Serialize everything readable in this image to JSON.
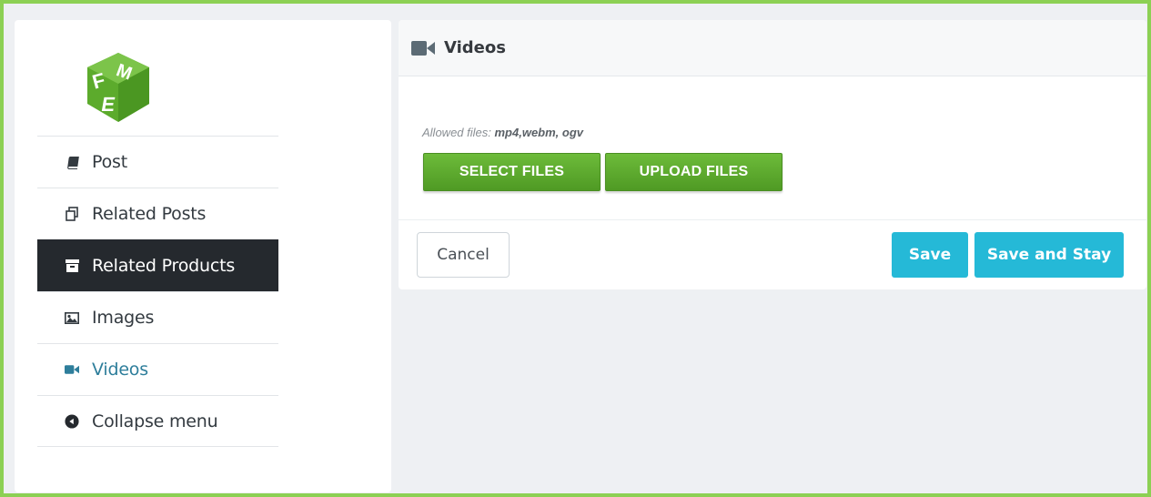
{
  "sidebar": {
    "logo_letters": "FME",
    "items": [
      {
        "label": "Post",
        "icon": "book-icon",
        "state": "normal"
      },
      {
        "label": "Related Posts",
        "icon": "copy-icon",
        "state": "normal"
      },
      {
        "label": "Related Products",
        "icon": "archive-box-icon",
        "state": "active"
      },
      {
        "label": "Images",
        "icon": "image-icon",
        "state": "normal"
      },
      {
        "label": "Videos",
        "icon": "video-camera-icon",
        "state": "current"
      },
      {
        "label": "Collapse menu",
        "icon": "collapse-arrow-icon",
        "state": "normal"
      }
    ]
  },
  "panel": {
    "title": "Videos",
    "title_icon": "video-camera-icon",
    "allowed_prefix": "Allowed files: ",
    "allowed_types": "mp4,webm, ogv",
    "select_label": "SELECT FILES",
    "upload_label": "UPLOAD FILES"
  },
  "footer": {
    "cancel_label": "Cancel",
    "save_label": "Save",
    "save_stay_label": "Save and Stay"
  },
  "colors": {
    "frame_border": "#8cd054",
    "active_bg": "#25292e",
    "current_text": "#2e7e9b",
    "primary_button": "#25b9d7",
    "green_button": "#5aa82d"
  }
}
